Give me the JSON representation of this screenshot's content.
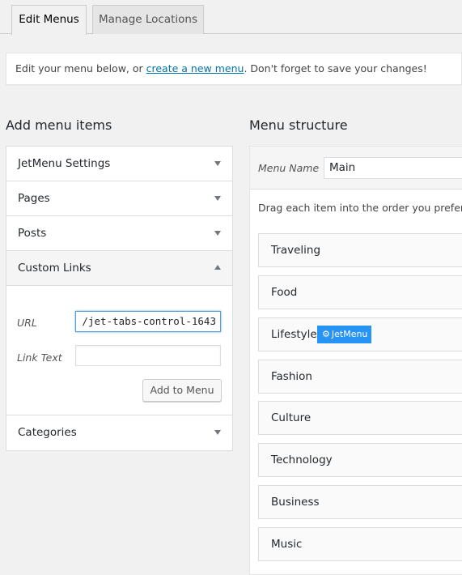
{
  "tabs": [
    {
      "label": "Edit Menus",
      "active": true
    },
    {
      "label": "Manage Locations",
      "active": false
    }
  ],
  "notice": {
    "before": "Edit your menu below, or ",
    "link": "create a new menu",
    "after": ". Don't forget to save your changes!"
  },
  "left": {
    "heading": "Add menu items",
    "sections": [
      {
        "label": "JetMenu Settings",
        "open": false
      },
      {
        "label": "Pages",
        "open": false
      },
      {
        "label": "Posts",
        "open": false
      },
      {
        "label": "Custom Links",
        "open": true
      },
      {
        "label": "Categories",
        "open": false
      }
    ],
    "custom_links": {
      "url_label": "URL",
      "url_value": "/jet-tabs-control-1643",
      "link_text_label": "Link Text",
      "link_text_value": "",
      "add_button": "Add to Menu"
    }
  },
  "right": {
    "heading": "Menu structure",
    "menu_name_label": "Menu Name",
    "menu_name_value": "Main",
    "drag_hint": "Drag each item into the order you prefer. Click",
    "items": [
      {
        "label": "Traveling"
      },
      {
        "label": "Food"
      },
      {
        "label": "Lifestyle",
        "badge": "JetMenu"
      },
      {
        "label": "Fashion"
      },
      {
        "label": "Culture"
      },
      {
        "label": "Technology"
      },
      {
        "label": "Business"
      },
      {
        "label": "Music"
      }
    ],
    "badge_color": "#2793f4"
  },
  "icons": {
    "collapsed": "triangle-down",
    "expanded": "triangle-up",
    "gear": "⚙"
  }
}
